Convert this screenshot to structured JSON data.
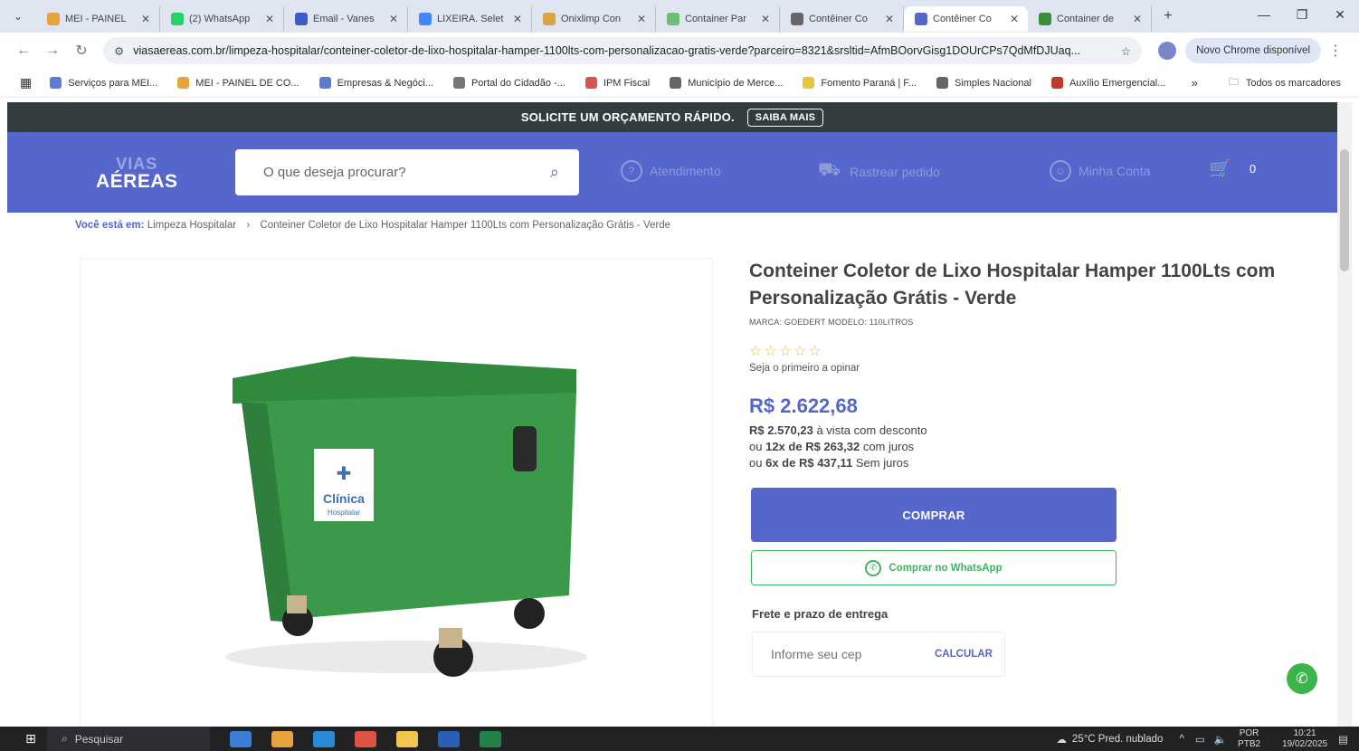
{
  "browser": {
    "tabs": [
      {
        "title": "MEI - PAINEL",
        "color": "#e8a33d"
      },
      {
        "title": "(2) WhatsApp",
        "color": "#25d366"
      },
      {
        "title": "Email - Vanes",
        "color": "#3b5cc4"
      },
      {
        "title": "LIXEIRA. Selet",
        "color": "#4285f4"
      },
      {
        "title": "Onixlimp Con",
        "color": "#d9a441"
      },
      {
        "title": "Container Par",
        "color": "#6fbf73"
      },
      {
        "title": "Contêiner Co",
        "color": "#666666"
      },
      {
        "title": "Contêiner Co",
        "color": "#5566cc",
        "active": true
      },
      {
        "title": "Container de",
        "color": "#3b8f3b"
      }
    ],
    "url": "viasaereas.com.br/limpeza-hospitalar/conteiner-coletor-de-lixo-hospitalar-hamper-1100lts-com-personalizacao-gratis-verde?parceiro=8321&srsltid=AfmBOorvGisg1DOUrCPs7QdMfDJUaq...",
    "update_label": "Novo Chrome disponível",
    "bookmarks": [
      {
        "label": "Serviços para MEI...",
        "color": "#5b7bd6"
      },
      {
        "label": "MEI - PAINEL DE CO...",
        "color": "#e8a33d"
      },
      {
        "label": "Empresas & Negóci...",
        "color": "#5b7bd6"
      },
      {
        "label": "Portal do Cidadão -...",
        "color": "#777777"
      },
      {
        "label": "IPM Fiscal",
        "color": "#d9534f"
      },
      {
        "label": "Município de Merce...",
        "color": "#666666"
      },
      {
        "label": "Fomento Paraná | F...",
        "color": "#e8c33d"
      },
      {
        "label": "Simples Nacional",
        "color": "#666666"
      },
      {
        "label": "Auxílio Emergencial...",
        "color": "#c0392b"
      }
    ],
    "all_bookmarks": "Todos os marcadores"
  },
  "site": {
    "banner_text": "SOLICITE UM ORÇAMENTO RÁPIDO.",
    "banner_button": "SAIBA MAIS",
    "logo_line1": "VIAS",
    "logo_line2": "AÉREAS",
    "search_placeholder": "O que deseja procurar?",
    "nav": {
      "atendimento": "Atendimento",
      "rastrear": "Rastrear pedido",
      "conta": "Minha Conta",
      "cart_count": "0"
    },
    "breadcrumb": {
      "prefix": "Você está em:",
      "category": "Limpeza Hospitalar",
      "current": "Conteiner Coletor de Lixo Hospitalar Hamper 1100Lts com Personalização Grátis - Verde"
    }
  },
  "product": {
    "title": "Conteiner Coletor de Lixo Hospitalar Hamper 1100Lts com Personalização Grátis - Verde",
    "brand_model": "MARCA: GOEDERT  MODELO: 110LITROS",
    "rating_stars": 0,
    "rating_text": "Seja o primeiro a opinar",
    "price": "R$ 2.622,68",
    "price_cash_value": "R$ 2.570,23",
    "price_cash_text": "à vista com desconto",
    "installments_12_prefix": "ou",
    "installments_12_count": "12x de",
    "installments_12_value": "R$ 263,32",
    "installments_12_text": "com juros",
    "installments_6_prefix": "ou",
    "installments_6_count": "6x de",
    "installments_6_value": "R$ 437,11",
    "installments_6_text": "Sem juros",
    "buy_label": "COMPRAR",
    "whatsapp_label": "Comprar no WhatsApp",
    "shipping_title": "Frete e prazo de entrega",
    "cep_placeholder": "Informe seu cep",
    "calc_label": "CALCULAR",
    "image_label_1": "Clínica",
    "image_label_2": "Hospitalar"
  },
  "taskbar": {
    "search_placeholder": "Pesquisar",
    "weather": "25°C  Pred. nublado",
    "lang1": "POR",
    "lang2": "PTB2",
    "time": "10:21",
    "date": "19/02/2025"
  }
}
